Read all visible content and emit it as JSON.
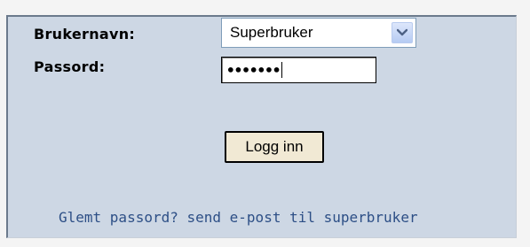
{
  "login_form": {
    "username_label": "Brukernavn:",
    "password_label": "Passord:",
    "username_selected": "Superbruker",
    "password_masked": "•••••••",
    "submit_label": "Logg inn",
    "forgot_text": "Glemt passord? send e-post til superbruker"
  },
  "icons": {
    "dropdown_arrow": "chevron-down-icon"
  },
  "colors": {
    "panel_background": "#cdd7e4",
    "link": "#2d4f86",
    "button_background": "#f1e9d4"
  }
}
